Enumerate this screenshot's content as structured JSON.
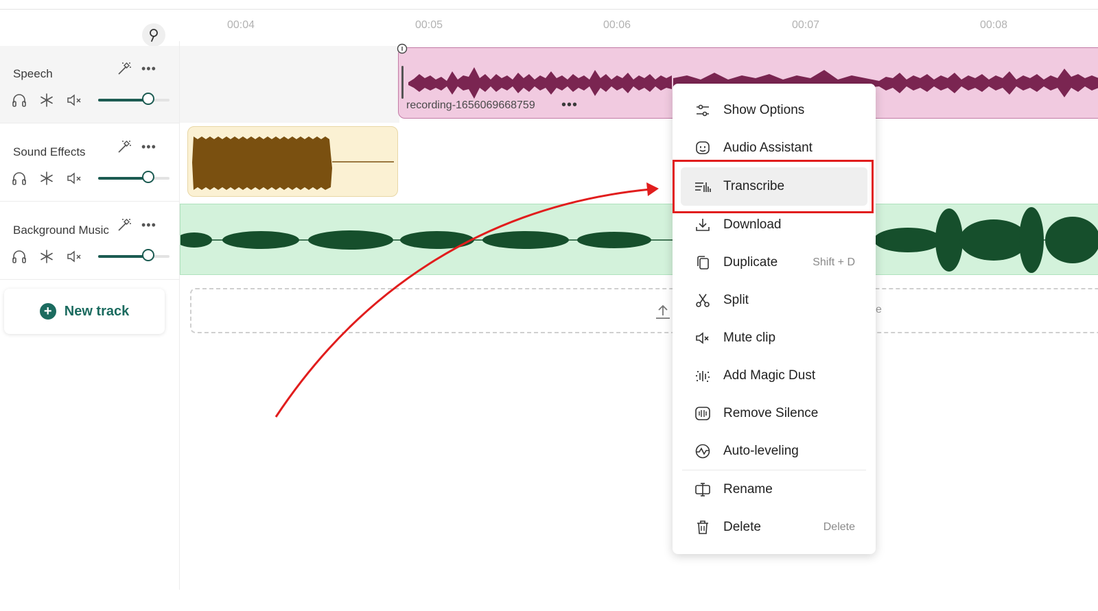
{
  "timeline": {
    "ticks": [
      "00:04",
      "00:05",
      "00:06",
      "00:07",
      "00:08"
    ]
  },
  "tracks": [
    {
      "name": "Speech"
    },
    {
      "name": "Sound Effects"
    },
    {
      "name": "Background Music"
    }
  ],
  "new_track_label": "New track",
  "speech_clip": {
    "name": "recording-1656069668759"
  },
  "dropzone": {
    "tail_text": "e"
  },
  "context_menu": {
    "items": [
      {
        "label": "Show Options",
        "shortcut": "",
        "icon": "sliders-icon"
      },
      {
        "label": "Audio Assistant",
        "shortcut": "",
        "icon": "assistant-icon"
      },
      {
        "label": "Transcribe",
        "shortcut": "",
        "icon": "transcribe-icon"
      },
      {
        "label": "Download",
        "shortcut": "",
        "icon": "download-icon"
      },
      {
        "label": "Duplicate",
        "shortcut": "Shift + D",
        "icon": "duplicate-icon"
      },
      {
        "label": "Split",
        "shortcut": "",
        "icon": "scissors-icon"
      },
      {
        "label": "Mute clip",
        "shortcut": "",
        "icon": "mute-icon"
      },
      {
        "label": "Add Magic Dust",
        "shortcut": "",
        "icon": "magic-dust-icon"
      },
      {
        "label": "Remove Silence",
        "shortcut": "",
        "icon": "remove-silence-icon"
      },
      {
        "label": "Auto-leveling",
        "shortcut": "",
        "icon": "auto-level-icon"
      },
      {
        "label": "Rename",
        "shortcut": "",
        "icon": "rename-icon"
      },
      {
        "label": "Delete",
        "shortcut": "Delete",
        "icon": "trash-icon"
      }
    ],
    "highlighted": "Transcribe"
  },
  "colors": {
    "accent": "#1b6b5f",
    "speech_clip": "#f1cae0",
    "speech_wave": "#7a2551",
    "sfx_clip": "#fbf1d3",
    "sfx_wave": "#7a5010",
    "music_clip": "#d3f2db",
    "music_wave": "#164f2c",
    "annotation": "#e11d1d"
  },
  "volumes": [
    0.7,
    0.7,
    0.7
  ]
}
